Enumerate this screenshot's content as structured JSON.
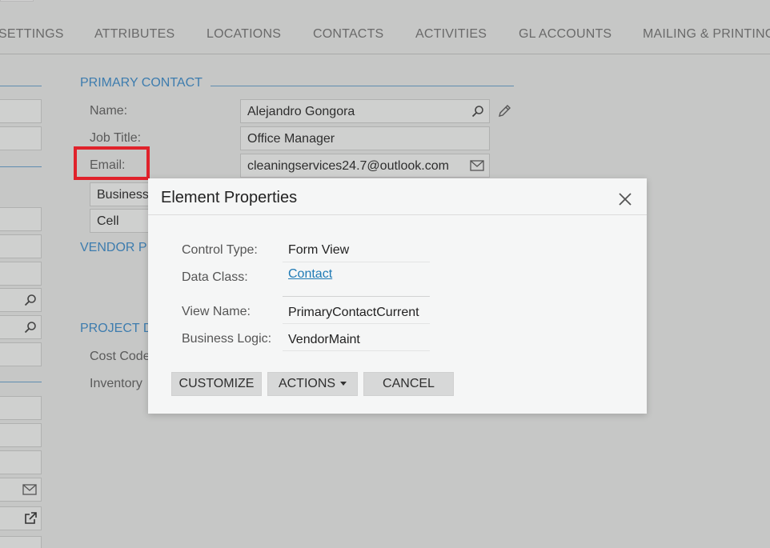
{
  "tabs": [
    "SETTINGS",
    "ATTRIBUTES",
    "LOCATIONS",
    "CONTACTS",
    "ACTIVITIES",
    "GL ACCOUNTS",
    "MAILING & PRINTING"
  ],
  "primary_contact": {
    "header": "PRIMARY CONTACT",
    "name_label": "Name:",
    "name_value": "Alejandro Gongora",
    "job_title_label": "Job Title:",
    "job_title_value": "Office Manager",
    "email_label": "Email:",
    "email_value": "cleaningservices24.7@outlook.com",
    "phone1_type": "Business",
    "phone2_type": "Cell"
  },
  "vendor_section": {
    "header_partial": "VENDOR P"
  },
  "project_section": {
    "header_partial": "PROJECT D",
    "cost_code_label": "Cost Code",
    "inventory_label": "Inventory"
  },
  "dialog": {
    "title": "Element Properties",
    "control_type_label": "Control Type:",
    "control_type_value": "Form View",
    "data_class_label": "Data Class:",
    "data_class_value": "Contact",
    "view_name_label": "View Name:",
    "view_name_value": "PrimaryContactCurrent",
    "business_logic_label": "Business Logic:",
    "business_logic_value": "VendorMaint",
    "customize_label": "CUSTOMIZE",
    "actions_label": "ACTIONS",
    "cancel_label": "CANCEL"
  },
  "icons": {
    "name_search": "search-icon",
    "name_edit": "pencil-icon",
    "email": "envelope-icon",
    "close": "close-icon",
    "external_link": "external-link-icon"
  },
  "colors": {
    "section_header": "#3d7cae",
    "highlight": "#e0222b",
    "link": "#1f7ab5"
  }
}
